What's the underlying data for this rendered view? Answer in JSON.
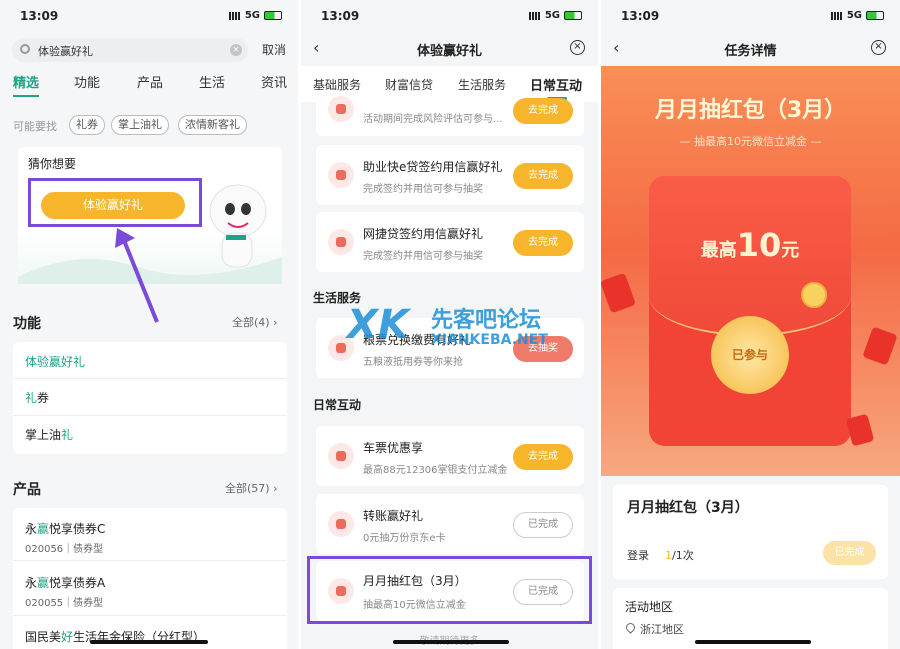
{
  "status": {
    "time": "13:09",
    "network": "5G"
  },
  "p1": {
    "search_value": "体验赢好礼",
    "cancel": "取消",
    "tabs": [
      "精选",
      "功能",
      "产品",
      "生活",
      "资讯"
    ],
    "maybe": "可能要找",
    "tags": [
      "礼券",
      "掌上油礼",
      "浓情新客礼"
    ],
    "guess_title": "猜你想要",
    "guess_btn": "体验赢好礼",
    "func_title": "功能",
    "func_all": "全部(4)",
    "func_items": [
      {
        "hl": "体验赢好礼",
        "rest": ""
      },
      {
        "hl": "礼",
        "rest": "券"
      },
      {
        "pre": "掌上油",
        "hl": "礼"
      }
    ],
    "prod_title": "产品",
    "prod_all": "全部(57)",
    "prod_items": [
      {
        "pre": "永",
        "hl": "赢",
        "rest": "悦享债券C",
        "sub": "020056｜债券型"
      },
      {
        "pre": "永",
        "hl": "赢",
        "rest": "悦享债券A",
        "sub": "020055｜债券型"
      },
      {
        "pre": "国民美",
        "hl": "好",
        "rest": "生活年金保险（分红型）"
      }
    ]
  },
  "p2": {
    "title": "体验赢好礼",
    "tabs": [
      "基础服务",
      "财富信贷",
      "生活服务",
      "日常互动"
    ],
    "top_sub": "活动期间完成风险评估可参与...",
    "top_btn": "去完成",
    "items": [
      {
        "title": "助业快e贷签约用信赢好礼",
        "sub": "完成签约并用信可参与抽奖",
        "btn": "去完成"
      },
      {
        "title": "网捷贷签约用信赢好礼",
        "sub": "完成签约并用信可参与抽奖",
        "btn": "去完成"
      }
    ],
    "life_title": "生活服务",
    "life_item": {
      "title": "粮票兑换缴费有好礼",
      "sub": "五粮液抵用券等你来抢",
      "btn": "去抽奖"
    },
    "daily_title": "日常互动",
    "daily": [
      {
        "title": "车票优惠享",
        "sub": "最高88元12306掌银支付立减金",
        "btn": "去完成"
      },
      {
        "title": "转账赢好礼",
        "sub": "0元抽万份京东e卡",
        "btn": "已完成"
      },
      {
        "title": "月月抽红包（3月）",
        "sub": "抽最高10元微信立减金",
        "btn": "已完成"
      }
    ],
    "more": "敬请期待更多",
    "watermark_cn": "先客吧论坛",
    "watermark_en": "XIANKEBA.NET",
    "watermark_logo": "XK"
  },
  "p3": {
    "title": "任务详情",
    "banner_title": "月月抽红包（3月）",
    "banner_sub": "抽最高10元微信立减金",
    "envelope_pre": "最高",
    "envelope_num": "10",
    "envelope_unit": "元",
    "seal": "已参与",
    "card_title": "月月抽红包（3月）",
    "login": "登录",
    "count_done": "1",
    "count_rest": "/1次",
    "done": "已完成",
    "area_title": "活动地区",
    "area": "浙江地区"
  },
  "colors": {
    "green": "#1fa386",
    "orange": "#f7b52c",
    "purple": "#7a4bd8",
    "red": "#f36a4a"
  }
}
